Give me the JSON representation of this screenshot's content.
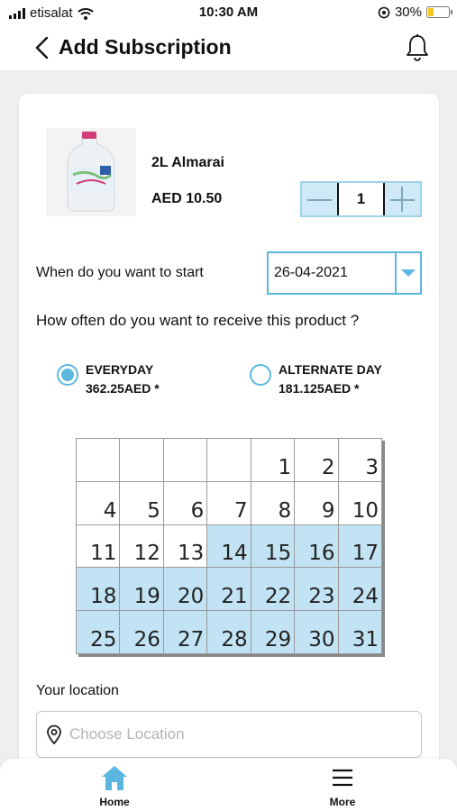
{
  "status_bar": {
    "carrier": "etisalat",
    "time": "10:30 AM",
    "battery_percent": "30%",
    "battery_level": 0.3
  },
  "header": {
    "title": "Add Subscription",
    "back_icon": "chevron-left-icon",
    "bell_icon": "bell-icon"
  },
  "product": {
    "name": "2L Almarai",
    "price": "AED 10.50",
    "quantity": "1"
  },
  "start": {
    "label": "When do you want to start",
    "date": "26-04-2021"
  },
  "frequency": {
    "question": "How often do you want to receive this product ?",
    "options": [
      {
        "label": "EVERYDAY",
        "price": "362.25AED *",
        "selected": true
      },
      {
        "label": "ALTERNATE DAY",
        "price": "181.125AED *",
        "selected": false
      }
    ]
  },
  "calendar": {
    "weeks": [
      [
        "",
        "",
        "",
        "",
        "1",
        "2",
        "3"
      ],
      [
        "4",
        "5",
        "6",
        "7",
        "8",
        "9",
        "10"
      ],
      [
        "11",
        "12",
        "13",
        "14",
        "15",
        "16",
        "17"
      ],
      [
        "18",
        "19",
        "20",
        "21",
        "22",
        "23",
        "24"
      ],
      [
        "25",
        "26",
        "27",
        "28",
        "29",
        "30",
        "31"
      ]
    ],
    "highlighted": [
      "14",
      "15",
      "16",
      "17",
      "18",
      "19",
      "20",
      "21",
      "22",
      "23",
      "24",
      "25",
      "26",
      "27",
      "28",
      "29",
      "30",
      "31"
    ],
    "highlight_color": "#c2e3f3"
  },
  "location": {
    "label": "Your location",
    "placeholder": "Choose Location"
  },
  "bottom_nav": {
    "home_label": "Home",
    "more_label": "More"
  },
  "colors": {
    "accent": "#5bb7e0",
    "accent_light": "#cfe9f6"
  }
}
